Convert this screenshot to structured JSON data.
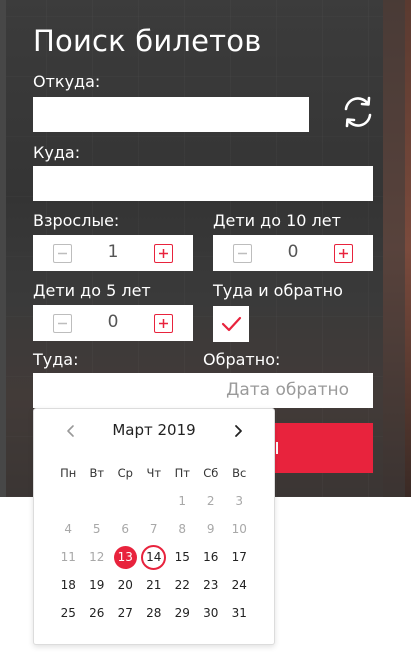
{
  "form": {
    "title": "Поиск билетов",
    "from_label": "Откуда:",
    "from_value": "",
    "to_label": "Куда:",
    "to_value": "",
    "adults_label": "Взрослые:",
    "adults_value": "1",
    "kids10_label": "Дети до 10 лет",
    "kids10_value": "0",
    "kids5_label": "Дети до 5 лет",
    "kids5_value": "0",
    "roundtrip_label": "Туда и обратно",
    "roundtrip_checked": true,
    "depart_label": "Туда:",
    "return_label": "Обратно:",
    "return_placeholder": "Дата обратно",
    "accent_color": "#e8233d"
  },
  "calendar": {
    "month": "Март 2019",
    "weekdays": [
      "Пн",
      "Вт",
      "Ср",
      "Чт",
      "Пт",
      "Сб",
      "Вс"
    ],
    "weeks": [
      [
        {
          "d": ""
        },
        {
          "d": ""
        },
        {
          "d": ""
        },
        {
          "d": ""
        },
        {
          "d": "1",
          "m": true
        },
        {
          "d": "2",
          "m": true
        },
        {
          "d": "3",
          "m": true
        }
      ],
      [
        {
          "d": "4",
          "m": true
        },
        {
          "d": "5",
          "m": true
        },
        {
          "d": "6",
          "m": true
        },
        {
          "d": "7",
          "m": true
        },
        {
          "d": "8",
          "m": true
        },
        {
          "d": "9",
          "m": true
        },
        {
          "d": "10",
          "m": true
        }
      ],
      [
        {
          "d": "11",
          "m": true
        },
        {
          "d": "12",
          "m": true
        },
        {
          "d": "13",
          "s": true
        },
        {
          "d": "14",
          "t": true
        },
        {
          "d": "15"
        },
        {
          "d": "16"
        },
        {
          "d": "17"
        }
      ],
      [
        {
          "d": "18"
        },
        {
          "d": "19"
        },
        {
          "d": "20"
        },
        {
          "d": "21"
        },
        {
          "d": "22"
        },
        {
          "d": "23"
        },
        {
          "d": "24"
        }
      ],
      [
        {
          "d": "25"
        },
        {
          "d": "26"
        },
        {
          "d": "27"
        },
        {
          "d": "28"
        },
        {
          "d": "29"
        },
        {
          "d": "30"
        },
        {
          "d": "31"
        }
      ]
    ]
  }
}
